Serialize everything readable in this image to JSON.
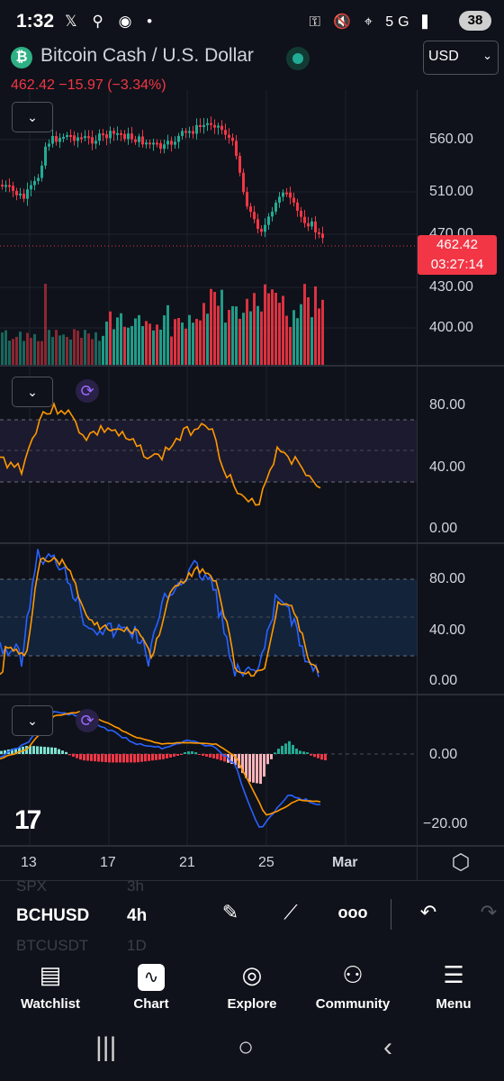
{
  "status_bar": {
    "time": "1:32",
    "left_icons": "𝕏 ⚲ ◉ •",
    "right_icons": "⚿ 🔇 ⌖ 5G ▍",
    "battery": "38"
  },
  "header": {
    "title": "Bitcoin Cash / U.S. Dollar",
    "coin_symbol": "₿",
    "currency": "USD",
    "price_line": "462.42  −15.97 (−3.34%)",
    "last_price": "462.42",
    "countdown": "03:27:14"
  },
  "price_axis": [
    "560.00",
    "510.00",
    "470.00",
    "430.00",
    "400.00"
  ],
  "rsi_axis": [
    "80.00",
    "40.00",
    "0.00"
  ],
  "stoch_axis": [
    "80.00",
    "40.00",
    "0.00"
  ],
  "macd_axis": [
    "0.00",
    "−20.00"
  ],
  "time_axis": [
    "13",
    "17",
    "21",
    "25",
    "Mar"
  ],
  "collapse_glyph": "⌄",
  "symbols": {
    "above": "SPX",
    "above_tf": "3h",
    "current": "BCHUSD",
    "current_tf": "4h",
    "below": "BTCUSDT",
    "below_tf": "1D"
  },
  "tools": {
    "draw": "✎",
    "lines": "⟋",
    "more": "ooo",
    "undo": "↶",
    "redo": "↷"
  },
  "nav": [
    {
      "label": "Watchlist",
      "icon": "▤"
    },
    {
      "label": "Chart",
      "icon": "∿"
    },
    {
      "label": "Explore",
      "icon": "◎"
    },
    {
      "label": "Community",
      "icon": "⚇"
    },
    {
      "label": "Menu",
      "icon": "☰"
    }
  ],
  "system_nav": {
    "recents": "|||",
    "home": "○",
    "back": "‹"
  },
  "colors": {
    "up": "#22ab94",
    "down": "#f23645",
    "rsi": "#ff9800",
    "stoch_k": "#2962ff",
    "bg": "#0f121a"
  }
}
